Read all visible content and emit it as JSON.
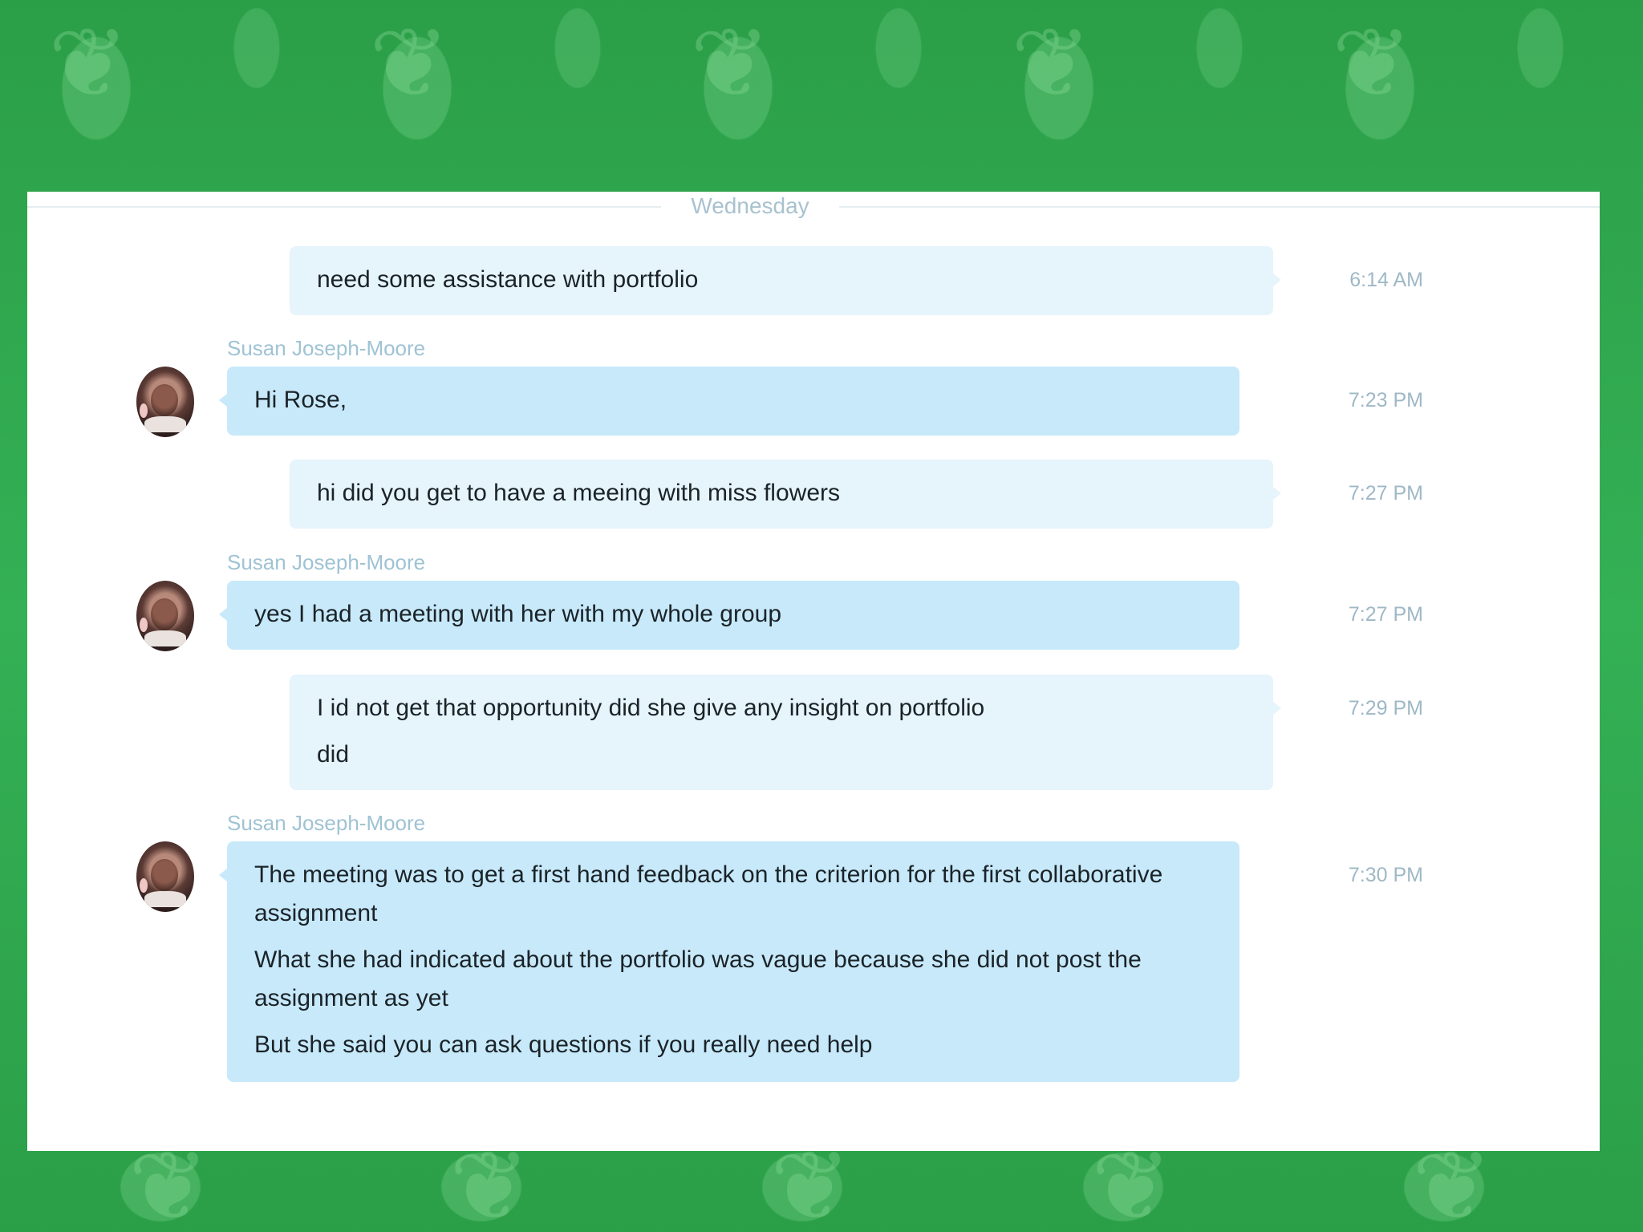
{
  "chat": {
    "day_label": "Wednesday",
    "messages": [
      {
        "direction": "out",
        "lines": [
          "need some assistance with portfolio"
        ],
        "time": "6:14 AM"
      },
      {
        "direction": "in",
        "sender": "Susan  Joseph-Moore",
        "lines": [
          "Hi Rose,"
        ],
        "time": "7:23 PM"
      },
      {
        "direction": "out",
        "lines": [
          "hi did you get to have a meeing with miss flowers"
        ],
        "time": "7:27 PM"
      },
      {
        "direction": "in",
        "sender": "Susan  Joseph-Moore",
        "lines": [
          "yes I had a meeting with her with my whole group"
        ],
        "time": "7:27 PM"
      },
      {
        "direction": "out",
        "lines": [
          "I id not get that opportunity did she give any insight on portfolio",
          "did"
        ],
        "time": "7:29 PM"
      },
      {
        "direction": "in",
        "sender": "Susan  Joseph-Moore",
        "lines": [
          "The meeting was to get a first hand feedback on the criterion for the first collaborative assignment",
          "What she had indicated about the portfolio was vague because she did not post the assignment as yet",
          "But she said you can ask questions if you really need help"
        ],
        "time": "7:30 PM"
      }
    ]
  },
  "colors": {
    "background": "#2fa84f",
    "outgoing_bubble": "#e6f4fc",
    "incoming_bubble": "#c7e9fa",
    "timestamp": "#9fb8c6",
    "sender_name": "#9fc3d4"
  }
}
